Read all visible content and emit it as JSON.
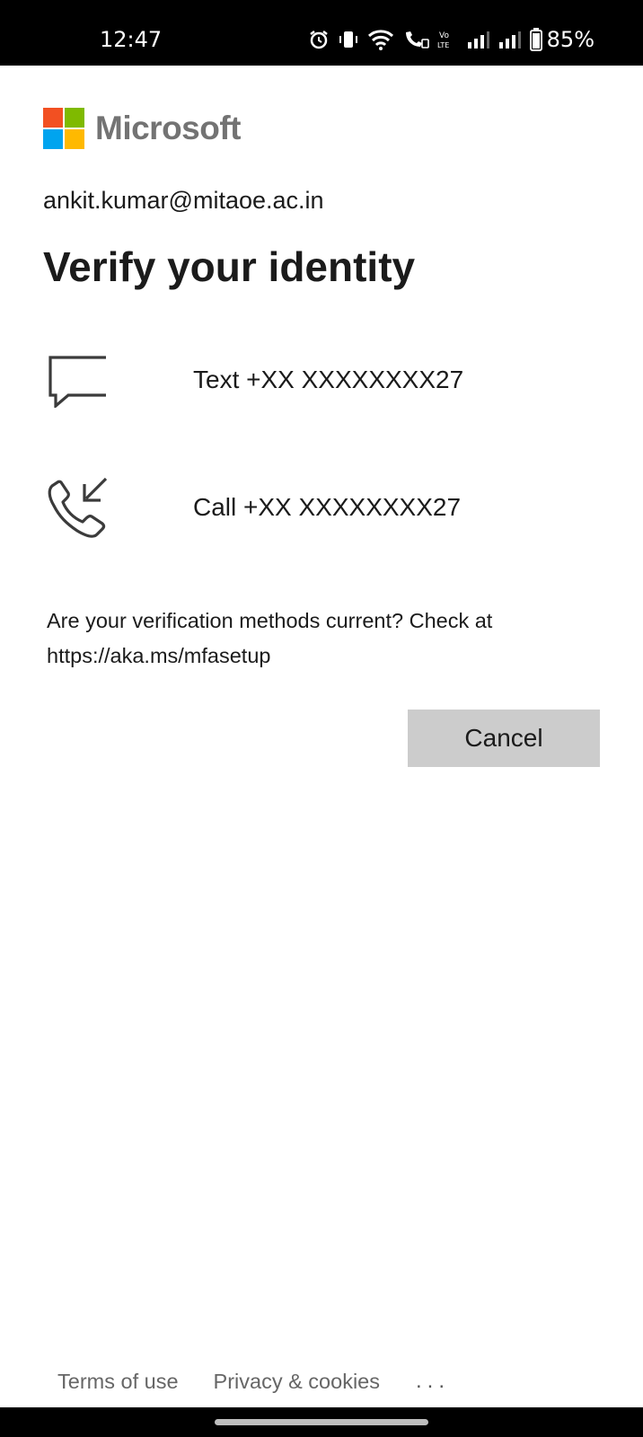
{
  "status_bar": {
    "time": "12:47",
    "battery_percent": "85%",
    "icons": [
      "alarm-icon",
      "vibrate-icon",
      "wifi-icon",
      "wifi-calling-icon",
      "volte-icon",
      "signal-icon",
      "signal-icon",
      "battery-icon"
    ]
  },
  "brand": {
    "name": "Microsoft",
    "colors": [
      "#f25022",
      "#7fba00",
      "#00a4ef",
      "#ffb900"
    ]
  },
  "account": "ankit.kumar@mitaoe.ac.in",
  "title": "Verify your identity",
  "options": [
    {
      "icon": "message-icon",
      "label": "Text +XX XXXXXXXX27"
    },
    {
      "icon": "phone-incoming-icon",
      "label": "Call +XX XXXXXXXX27"
    }
  ],
  "note": "Are your verification methods current? Check at https://aka.ms/mfasetup",
  "cancel_label": "Cancel",
  "footer": {
    "terms": "Terms of use",
    "privacy": "Privacy & cookies",
    "more": "..."
  }
}
